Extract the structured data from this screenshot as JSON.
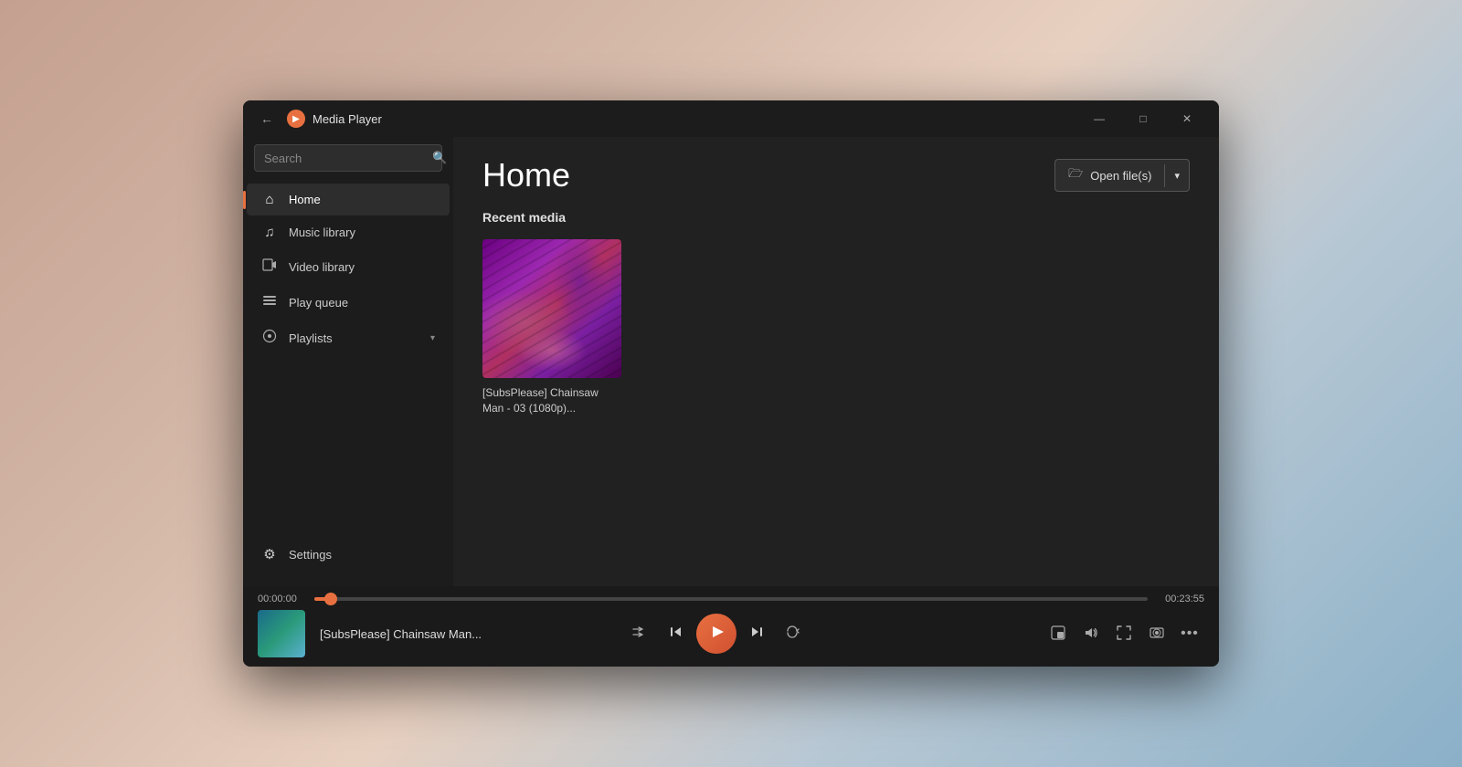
{
  "window": {
    "title": "Media Player",
    "app_icon": "▶"
  },
  "titlebar": {
    "back_label": "←",
    "minimize_label": "—",
    "maximize_label": "□",
    "close_label": "✕"
  },
  "sidebar": {
    "search_placeholder": "Search",
    "nav_items": [
      {
        "id": "home",
        "label": "Home",
        "icon": "⌂",
        "active": true
      },
      {
        "id": "music-library",
        "label": "Music library",
        "icon": "♫",
        "active": false
      },
      {
        "id": "video-library",
        "label": "Video library",
        "icon": "⊡",
        "active": false
      },
      {
        "id": "play-queue",
        "label": "Play queue",
        "icon": "≡",
        "active": false
      },
      {
        "id": "playlists",
        "label": "Playlists",
        "icon": "⊙",
        "active": false,
        "chevron": true
      }
    ],
    "settings_label": "Settings",
    "settings_icon": "⚙"
  },
  "content": {
    "page_title": "Home",
    "open_files_label": "Open file(s)",
    "open_files_icon": "🗁",
    "section_title": "Recent media",
    "media_items": [
      {
        "title": "[SubsPlease] Chainsaw Man - 03 (1080p)...",
        "short_title": "[SubsPlease] Chainsaw Man - 03 (1080p)..."
      }
    ]
  },
  "playback": {
    "current_time": "00:00:00",
    "total_time": "00:23:55",
    "progress_percent": 2,
    "track_title": "[SubsPlease] Chainsaw Man...",
    "shuffle_icon": "⇌",
    "prev_icon": "⏮",
    "play_icon": "▶",
    "next_icon": "⏭",
    "repeat_icon": "⇄",
    "miniplayer_icon": "⊡",
    "volume_icon": "🔊",
    "fullscreen_icon": "⤢",
    "cast_icon": "⊟",
    "more_icon": "⋯"
  }
}
